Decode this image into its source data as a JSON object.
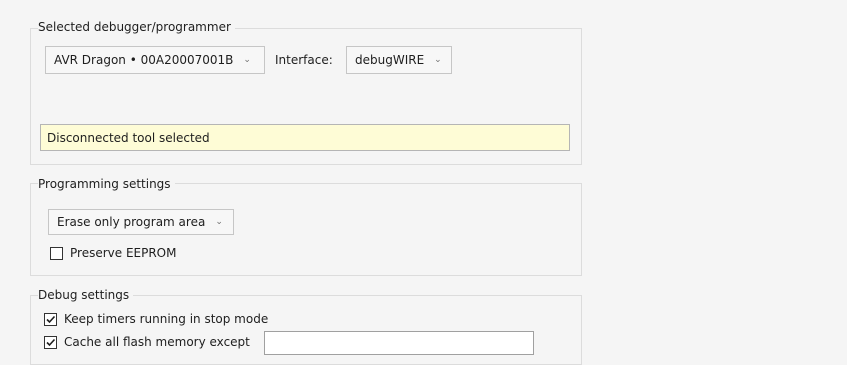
{
  "debugger_group": {
    "title": "Selected debugger/programmer",
    "tool_select": "AVR Dragon • 00A20007001B",
    "interface_label": "Interface:",
    "interface_select": "debugWIRE",
    "status_message": "Disconnected tool selected"
  },
  "programming_group": {
    "title": "Programming settings",
    "erase_select": "Erase only program area",
    "preserve_eeprom": {
      "label": "Preserve EEPROM",
      "checked": false
    }
  },
  "debug_group": {
    "title": "Debug settings",
    "keep_timers": {
      "label": "Keep timers running in stop mode",
      "checked": true
    },
    "cache_flash": {
      "label": "Cache all flash memory except",
      "checked": true,
      "value": ""
    }
  },
  "icons": {
    "dropdown": "chevron-down-icon",
    "check": "checkmark-icon"
  }
}
